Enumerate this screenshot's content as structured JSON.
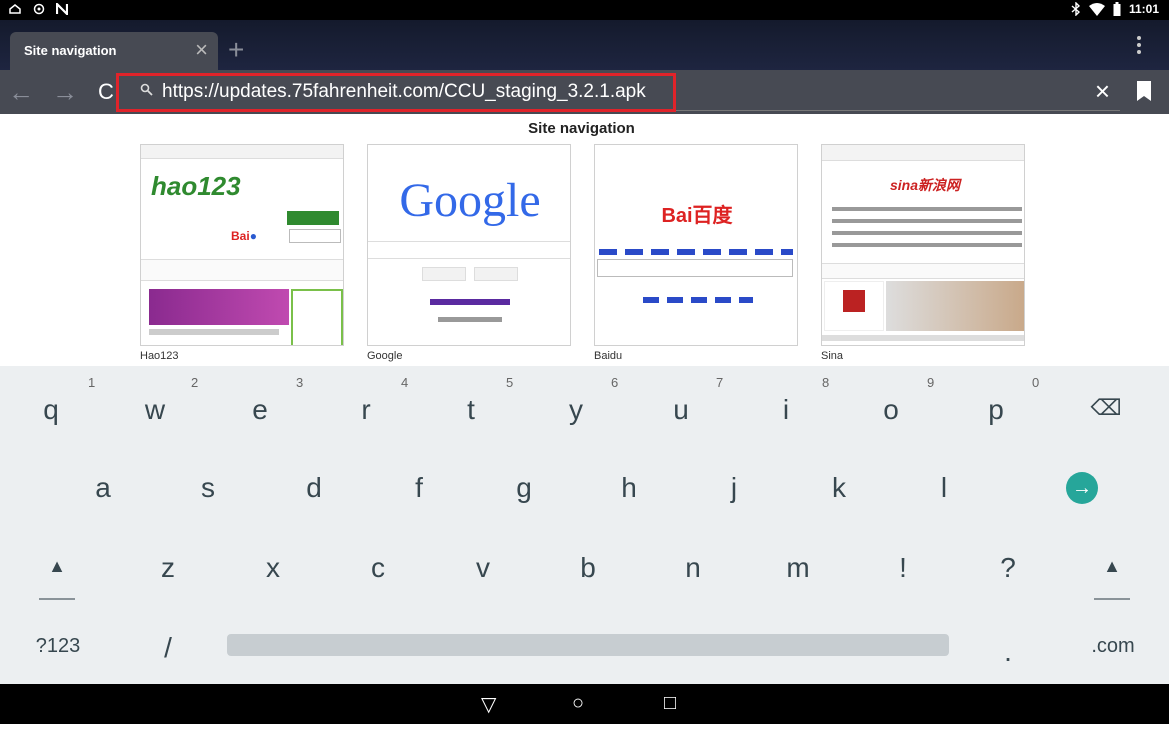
{
  "status_bar": {
    "time": "11:01",
    "left_icons": [
      "cloud-icon",
      "sync-icon",
      "n-icon"
    ],
    "right_icons": [
      "bluetooth-icon",
      "wifi-icon",
      "battery-icon"
    ]
  },
  "tabs": [
    {
      "title": "Site navigation"
    }
  ],
  "tab_bar": {
    "new_tab_glyph": "+",
    "close_glyph": "×"
  },
  "toolbar": {
    "url": "https://updates.75fahrenheit.com/CCU_staging_3.2.1.apk",
    "back_glyph": "←",
    "forward_glyph": "→",
    "reload_glyph": "C",
    "clear_glyph": "×"
  },
  "page": {
    "title": "Site navigation",
    "sites": [
      {
        "name": "Hao123",
        "logo": "hao123"
      },
      {
        "name": "Google",
        "logo": "Google"
      },
      {
        "name": "Baidu",
        "logo": "Bai百度"
      },
      {
        "name": "Sina",
        "logo": "sina新浪网"
      }
    ]
  },
  "keyboard": {
    "row1": [
      "q",
      "w",
      "e",
      "r",
      "t",
      "y",
      "u",
      "i",
      "o",
      "p"
    ],
    "row1_hints": [
      "1",
      "2",
      "3",
      "4",
      "5",
      "6",
      "7",
      "8",
      "9",
      "0"
    ],
    "row2": [
      "a",
      "s",
      "d",
      "f",
      "g",
      "h",
      "j",
      "k",
      "l"
    ],
    "row3": [
      "z",
      "x",
      "c",
      "v",
      "b",
      "n",
      "m",
      "!",
      "?"
    ],
    "row4": {
      "symbols": "?123",
      "slash": "/",
      "period": ".",
      "dotcom": ".com"
    },
    "enter_glyph": "→",
    "backspace_glyph": "⌫",
    "shift_glyph": "▲"
  },
  "navbar": {
    "back": "▽",
    "home": "○",
    "recents": "□"
  }
}
